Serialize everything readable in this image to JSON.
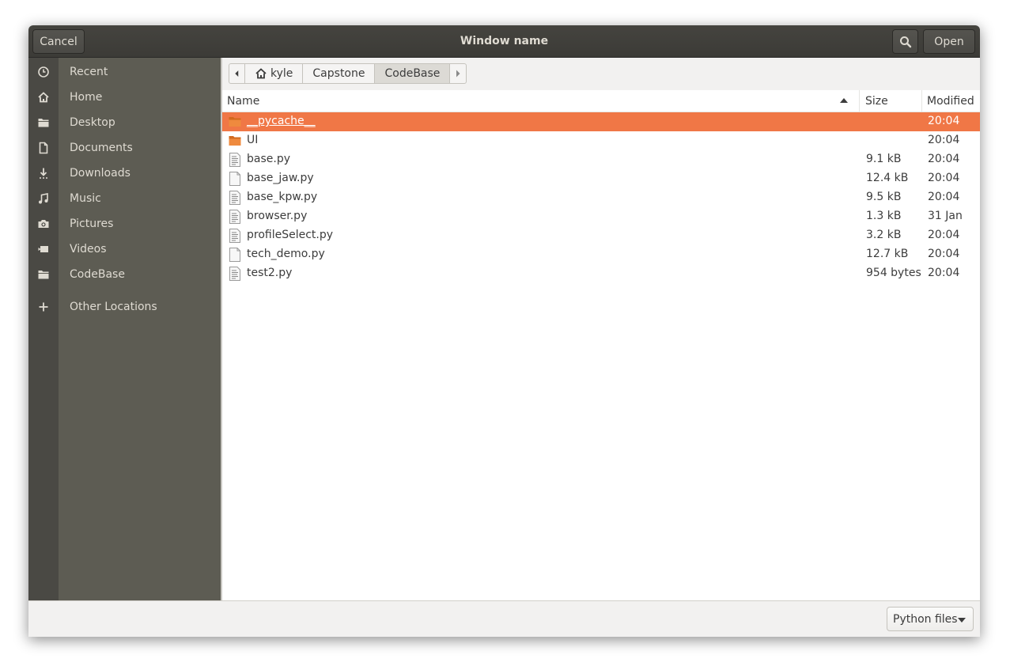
{
  "window": {
    "title": "Window name",
    "cancel_label": "Cancel",
    "open_label": "Open"
  },
  "sidebar": {
    "items": [
      {
        "label": "Recent",
        "icon": "clock-icon"
      },
      {
        "label": "Home",
        "icon": "home-icon"
      },
      {
        "label": "Desktop",
        "icon": "folder-icon"
      },
      {
        "label": "Documents",
        "icon": "document-icon"
      },
      {
        "label": "Downloads",
        "icon": "download-icon"
      },
      {
        "label": "Music",
        "icon": "music-icon"
      },
      {
        "label": "Pictures",
        "icon": "camera-icon"
      },
      {
        "label": "Videos",
        "icon": "video-icon"
      },
      {
        "label": "CodeBase",
        "icon": "folder-icon"
      }
    ],
    "other_locations": "Other Locations"
  },
  "pathbar": {
    "crumbs": [
      "kyle",
      "Capstone",
      "CodeBase"
    ]
  },
  "columns": {
    "name": "Name",
    "size": "Size",
    "modified": "Modified"
  },
  "files": [
    {
      "name": "__pycache__",
      "size": "",
      "modified": "20:04",
      "type": "folder",
      "selected": true
    },
    {
      "name": "UI",
      "size": "",
      "modified": "20:04",
      "type": "folder"
    },
    {
      "name": "base.py",
      "size": "9.1 kB",
      "modified": "20:04",
      "type": "script"
    },
    {
      "name": "base_jaw.py",
      "size": "12.4 kB",
      "modified": "20:04",
      "type": "blank"
    },
    {
      "name": "base_kpw.py",
      "size": "9.5 kB",
      "modified": "20:04",
      "type": "script"
    },
    {
      "name": "browser.py",
      "size": "1.3 kB",
      "modified": "31 Jan",
      "type": "script"
    },
    {
      "name": "profileSelect.py",
      "size": "3.2 kB",
      "modified": "20:04",
      "type": "script"
    },
    {
      "name": "tech_demo.py",
      "size": "12.7 kB",
      "modified": "20:04",
      "type": "blank"
    },
    {
      "name": "test2.py",
      "size": "954 bytes",
      "modified": "20:04",
      "type": "script"
    }
  ],
  "footer": {
    "filter_value": "Python files"
  },
  "colors": {
    "selection": "#f07746",
    "sidebar_bg": "#5d5c53",
    "titlebar_bg": "#3c3b37"
  }
}
